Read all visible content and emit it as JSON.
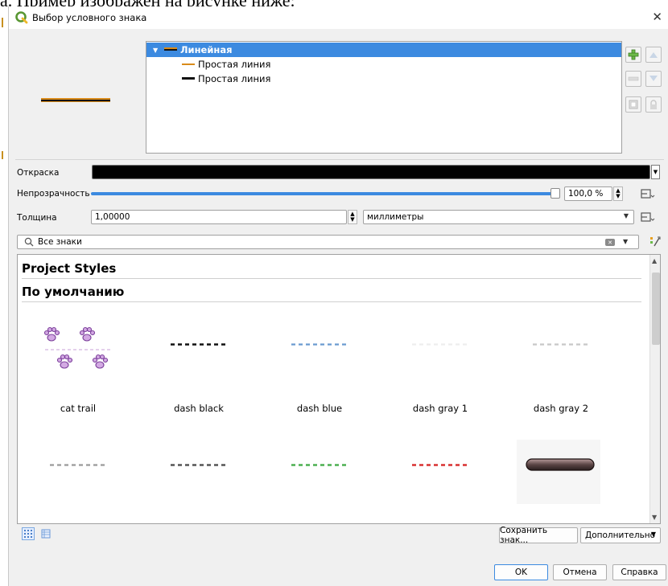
{
  "doc_text": "а. Пример изображен на рисунке ниже:",
  "window": {
    "title": "Выбор условного знака",
    "close_symbol": "✕"
  },
  "layer_tree": {
    "items": [
      {
        "label": "Линейная",
        "selected": true,
        "swatch": [
          "#d98b1a",
          "#111111"
        ]
      },
      {
        "label": "Простая линия",
        "selected": false,
        "swatch": [
          "#d98b1a"
        ]
      },
      {
        "label": "Простая линия",
        "selected": false,
        "swatch": [
          "#111111"
        ]
      }
    ],
    "buttons": [
      "add-layer",
      "move-up",
      "remove-layer",
      "move-down",
      "duplicate-layer",
      "lock-layer"
    ]
  },
  "properties": {
    "color_label": "Откраска",
    "color_value": "#000000",
    "opacity_label": "Непрозрачность",
    "opacity_value": "100,0 %",
    "opacity_fraction": 1.0,
    "width_label": "Толщина",
    "width_value": "1,00000",
    "unit_value": "миллиметры"
  },
  "search": {
    "placeholder": "Все знаки",
    "clear_symbol": "⌫"
  },
  "gallery": {
    "groups": [
      "Project Styles",
      "По умолчанию"
    ],
    "row1": [
      {
        "label": "cat trail",
        "kind": "cat",
        "color": "#c9a0d8"
      },
      {
        "label": "dash  black",
        "kind": "dash",
        "color": "#111111"
      },
      {
        "label": "dash blue",
        "kind": "dash",
        "color": "#6a9bd0"
      },
      {
        "label": "dash gray 1",
        "kind": "dash",
        "color": "#ededed"
      },
      {
        "label": "dash gray 2",
        "kind": "dash",
        "color": "#c8c8c8"
      }
    ],
    "row2": [
      {
        "label": "",
        "kind": "dash",
        "color": "#9a9a9a"
      },
      {
        "label": "",
        "kind": "dash",
        "color": "#555555"
      },
      {
        "label": "",
        "kind": "dash",
        "color": "#4caf50"
      },
      {
        "label": "",
        "kind": "dash",
        "color": "#d83030"
      },
      {
        "label": "",
        "kind": "pill",
        "color": "#5a4545"
      }
    ]
  },
  "footer": {
    "save_symbol": "Сохранить знак...",
    "advanced": "Дополнительно",
    "ok": "OK",
    "cancel": "Отмена",
    "help": "Справка"
  }
}
